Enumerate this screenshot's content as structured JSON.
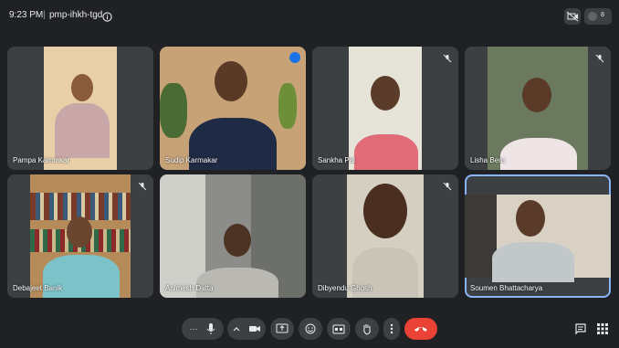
{
  "meeting": {
    "time": "9:23 PM",
    "separator": "|",
    "code": "pmp-ihkh-tgd"
  },
  "top_right": {
    "people_badge": "8"
  },
  "participants": [
    {
      "name": "Pampa Karmakar",
      "muted": false
    },
    {
      "name": "Sudip Karmakar",
      "muted": false,
      "speaking": true
    },
    {
      "name": "Sankha Pal",
      "muted": true
    },
    {
      "name": "Lisha Bera",
      "muted": true
    },
    {
      "name": "Debajeet Banik",
      "muted": true
    },
    {
      "name": "Animesh Datta",
      "muted": false
    },
    {
      "name": "Dibyendu Ghosh",
      "muted": true
    },
    {
      "name": "Soumen Bhattacharya",
      "muted": false,
      "pinned_focus": true
    }
  ],
  "controls": {
    "more_label": "···",
    "end_call_color": "#ea4335",
    "accent": "#8ab4f8"
  }
}
